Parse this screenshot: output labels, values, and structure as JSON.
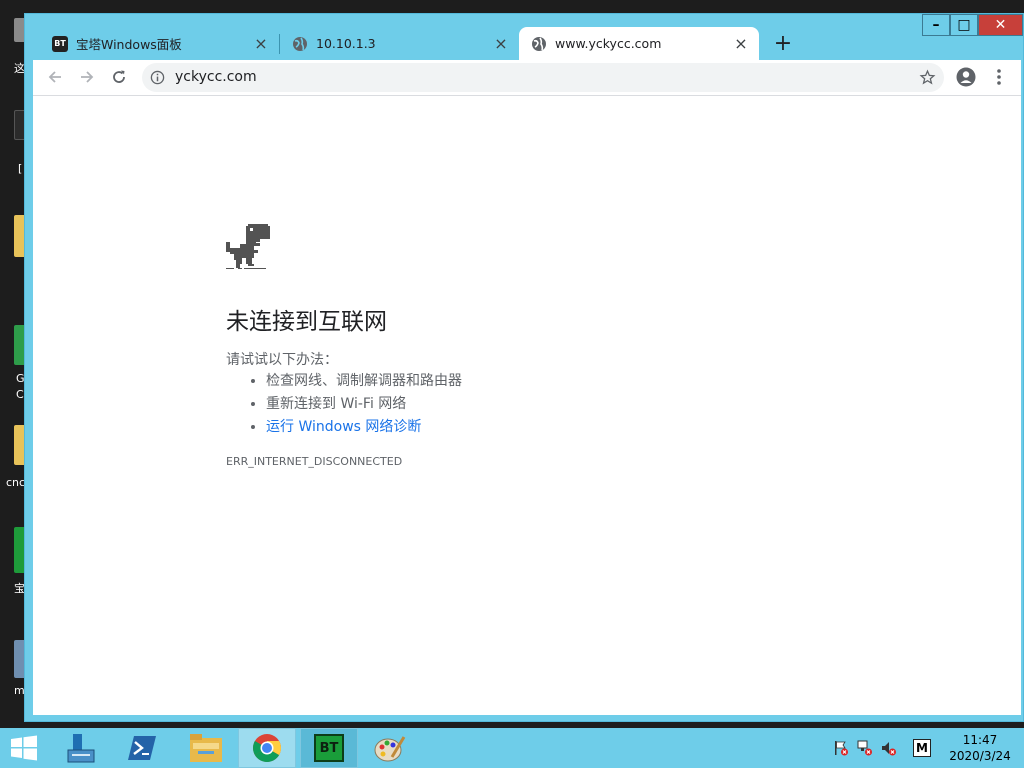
{
  "desktop": {
    "labels": [
      "这",
      "[",
      "G",
      "C",
      "cnc",
      "宝",
      "m"
    ]
  },
  "browser": {
    "tabs": [
      {
        "title": "宝塔Windows面板",
        "favicon_text": "BT"
      },
      {
        "title": "10.10.1.3"
      },
      {
        "title": "www.yckycc.com"
      }
    ],
    "tab_close_glyph": "×",
    "new_tab_glyph": "+",
    "window_controls": {
      "minimize": "–",
      "maximize": "□",
      "close": "✕"
    },
    "address": "yckycc.com",
    "colors": {
      "chrome_frame": "#6ecde9",
      "close_red": "#c7403a",
      "link_blue": "#1a73e8"
    }
  },
  "error_page": {
    "title": "未连接到互联网",
    "intro": "请试试以下办法：",
    "suggestions": [
      "检查网线、调制解调器和路由器",
      "重新连接到 Wi-Fi 网络"
    ],
    "diagnose_link": "运行 Windows 网络诊断",
    "code": "ERR_INTERNET_DISCONNECTED"
  },
  "taskbar": {
    "bt_label": "BT",
    "ime_label": "M",
    "time": "11:47",
    "date": "2020/3/24"
  }
}
